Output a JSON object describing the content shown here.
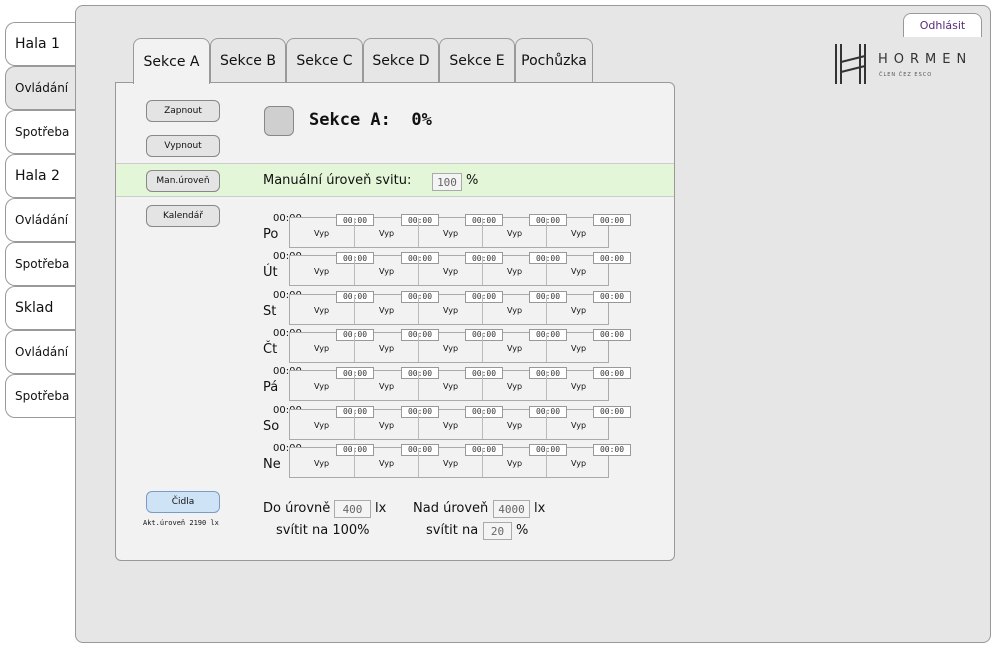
{
  "sidebar": {
    "items": [
      {
        "label": "Hala 1",
        "big": true
      },
      {
        "label": "Ovládání",
        "big": false
      },
      {
        "label": "Spotřeba",
        "big": false
      },
      {
        "label": "Hala 2",
        "big": true
      },
      {
        "label": "Ovládání",
        "big": false
      },
      {
        "label": "Spotřeba",
        "big": false
      },
      {
        "label": "Sklad",
        "big": true
      },
      {
        "label": "Ovládání",
        "big": false
      },
      {
        "label": "Spotřeba",
        "big": false
      }
    ],
    "active_index": 1
  },
  "header": {
    "logout_label": "Odhlásit",
    "logo_text": "HORMEN",
    "logo_subtitle": "ČLEN ČEZ ESCO"
  },
  "tabs": [
    "Sekce A",
    "Sekce B",
    "Sekce C",
    "Sekce D",
    "Sekce E",
    "Pochůzka"
  ],
  "active_tab": 0,
  "controls": {
    "on_label": "Zapnout",
    "off_label": "Vypnout",
    "manual_label": "Man.úroveň",
    "calendar_label": "Kalendář",
    "sensors_label": "Čidla"
  },
  "section": {
    "title": "Sekce A:",
    "value": "0%"
  },
  "manual": {
    "label": "Manuální úroveň svitu:",
    "value": "100",
    "unit": "%"
  },
  "calendar": {
    "days": [
      "Po",
      "Út",
      "St",
      "Čt",
      "Pá",
      "So",
      "Ne"
    ],
    "start_time": "00:00",
    "slot_time": "00:00",
    "slot_state": "Vyp",
    "slots_per_day": 5
  },
  "sensors": {
    "current_level_text": "Akt.úroveň 2190 lx",
    "below_label": "Do úrovně",
    "below_value": "400",
    "below_unit": "lx",
    "below_action": "svítit na 100%",
    "above_label": "Nad úroveň",
    "above_value": "4000",
    "above_unit": "lx",
    "above_action": "svítit na",
    "above_percent": "20",
    "above_percent_unit": "%"
  }
}
